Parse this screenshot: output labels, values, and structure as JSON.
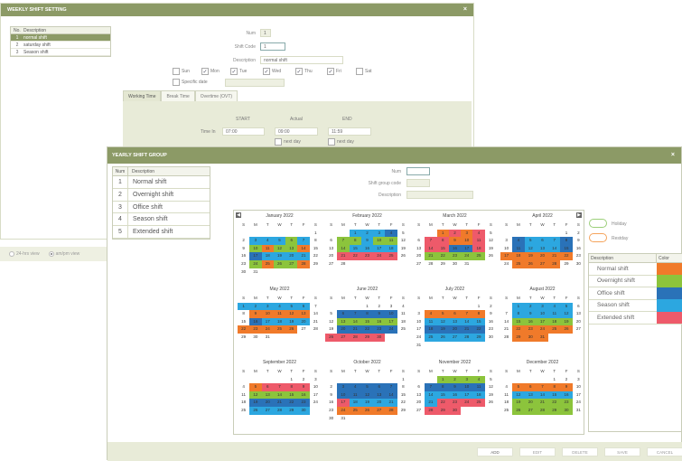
{
  "weekly": {
    "title": "WEEKLY SHIFT SETTING",
    "close": "×",
    "list": {
      "col_no": "No.",
      "col_desc": "Description",
      "rows": [
        {
          "no": "1",
          "desc": "normal shift"
        },
        {
          "no": "2",
          "desc": "saturday shift"
        },
        {
          "no": "3",
          "desc": "Season shift"
        }
      ]
    },
    "form": {
      "num_label": "Num",
      "num_value": "1",
      "code_label": "Shift Code",
      "code_value": "1",
      "desc_label": "Description",
      "desc_value": "normal shift",
      "days": [
        {
          "label": "Sun",
          "checked": false
        },
        {
          "label": "Mon",
          "checked": true
        },
        {
          "label": "Tue",
          "checked": true
        },
        {
          "label": "Wed",
          "checked": true
        },
        {
          "label": "Thu",
          "checked": true
        },
        {
          "label": "Fri",
          "checked": true
        },
        {
          "label": "Sat",
          "checked": false
        }
      ],
      "specific_label": "Specific date",
      "check_mark": "✓"
    },
    "tabs": [
      "Working Time",
      "Break Time",
      "Overtime (OVT)"
    ],
    "time": {
      "start_label": "START",
      "actual_label": "Actual",
      "end_label": "END",
      "timein_label": "Time In",
      "start_value": "07:00",
      "actual_value": "09:00",
      "end_value": "11:59",
      "next_day": "next day"
    }
  },
  "view_radios": [
    {
      "label": "24-hrs view",
      "on": false
    },
    {
      "label": "am/pm view",
      "on": true
    }
  ],
  "yearly": {
    "title": "YEARLY SHIFT GROUP",
    "close": "×",
    "list": {
      "col_no": "Num",
      "col_desc": "Description",
      "rows": [
        {
          "no": "1",
          "desc": "Normal shift"
        },
        {
          "no": "2",
          "desc": "Overnight shift"
        },
        {
          "no": "3",
          "desc": "Office shift"
        },
        {
          "no": "4",
          "desc": "Season shift"
        },
        {
          "no": "5",
          "desc": "Extended shift"
        }
      ]
    },
    "form": {
      "num_label": "Num",
      "num_value": "",
      "code_label": "Shift group code",
      "desc_label": "Description"
    },
    "nav_prev": "◀",
    "nav_next": "▶",
    "holiday_label": "Holiday",
    "restday_label": "Restday",
    "legend": {
      "col_desc": "Description",
      "col_color": "Color",
      "rows": [
        {
          "desc": "Normal shift",
          "color": "#f07a2a"
        },
        {
          "desc": "Overnight shift",
          "color": "#8cc43c"
        },
        {
          "desc": "Office shift",
          "color": "#2a72b8"
        },
        {
          "desc": "Season shift",
          "color": "#2ca7e0"
        },
        {
          "desc": "Extended shift",
          "color": "#ee5a6a"
        }
      ]
    },
    "buttons": [
      "ADD",
      "EDIT",
      "DELETE",
      "SAVE",
      "CANCEL"
    ],
    "weekday_headers": [
      "S",
      "M",
      "T",
      "W",
      "T",
      "F",
      "S"
    ],
    "colors": {
      "o": "#f07a2a",
      "g": "#8cc43c",
      "d": "#2a72b8",
      "b": "#2ca7e0",
      "r": "#ee5a6a"
    },
    "months": [
      {
        "name": "January 2022",
        "first": 6,
        "days": 31,
        "colors": "....._.b"
      },
      {
        "name": "February 2022",
        "first": 2,
        "days": 28
      },
      {
        "name": "March 2022",
        "first": 2,
        "days": 31
      },
      {
        "name": "April 2022",
        "first": 5,
        "days": 30
      },
      {
        "name": "May 2022",
        "first": 0,
        "days": 31
      },
      {
        "name": "June 2022",
        "first": 3,
        "days": 30
      },
      {
        "name": "July 2022",
        "first": 5,
        "days": 31
      },
      {
        "name": "August 2022",
        "first": 1,
        "days": 31
      },
      {
        "name": "September 2022",
        "first": 4,
        "days": 30
      },
      {
        "name": "October 2022",
        "first": 6,
        "days": 31
      },
      {
        "name": "November 2022",
        "first": 2,
        "days": 30
      },
      {
        "name": "December 2022",
        "first": 4,
        "days": 31
      }
    ],
    "month_colors": [
      {
        "3": "b",
        "4": "b",
        "5": "b",
        "6": "g",
        "7": "b",
        "10": "g",
        "11": "o",
        "12": "g",
        "13": "g",
        "14": "o",
        "17": "d",
        "18": "b",
        "19": "b",
        "20": "b",
        "21": "b",
        "24": "g",
        "25": "o",
        "26": "g",
        "27": "g",
        "28": "o"
      },
      {
        "1": "b",
        "2": "b",
        "3": "b",
        "4": "d",
        "7": "g",
        "8": "g",
        "9": "b",
        "10": "g",
        "11": "g",
        "14": "g",
        "15": "b",
        "16": "b",
        "17": "b",
        "18": "b",
        "21": "r",
        "22": "r",
        "23": "r",
        "24": "r",
        "25": "r"
      },
      {
        "1": "o",
        "2": "r",
        "3": "o",
        "4": "r",
        "7": "r",
        "8": "r",
        "9": "o",
        "10": "o",
        "11": "r",
        "14": "r",
        "15": "r",
        "16": "d",
        "17": "d",
        "18": "r",
        "21": "g",
        "22": "g",
        "23": "g",
        "24": "g",
        "25": "g"
      },
      {
        "4": "d",
        "5": "b",
        "6": "b",
        "7": "b",
        "8": "d",
        "11": "d",
        "12": "b",
        "13": "b",
        "14": "b",
        "15": "d",
        "17": "o",
        "18": "o",
        "19": "o",
        "20": "o",
        "21": "o",
        "22": "o",
        "25": "o",
        "26": "o",
        "27": "o",
        "28": "o"
      },
      {
        "1": "b",
        "2": "b",
        "3": "b",
        "4": "b",
        "5": "b",
        "6": "b",
        "9": "o",
        "10": "o",
        "11": "o",
        "12": "o",
        "13": "o",
        "16": "d",
        "17": "b",
        "18": "b",
        "19": "b",
        "20": "b",
        "22": "o",
        "23": "o",
        "24": "o",
        "25": "o",
        "26": "o"
      },
      {
        "6": "d",
        "7": "d",
        "8": "d",
        "9": "d",
        "10": "d",
        "13": "g",
        "14": "g",
        "15": "g",
        "16": "g",
        "17": "g",
        "20": "d",
        "21": "d",
        "22": "d",
        "23": "d",
        "24": "d",
        "26": "r",
        "27": "r",
        "28": "r",
        "29": "r",
        "30": "r"
      },
      {
        "4": "o",
        "5": "o",
        "6": "o",
        "7": "o",
        "8": "o",
        "11": "b",
        "12": "b",
        "13": "b",
        "14": "b",
        "15": "b",
        "18": "d",
        "19": "d",
        "20": "d",
        "21": "d",
        "22": "d",
        "25": "b",
        "26": "b",
        "27": "b",
        "28": "b",
        "29": "b"
      },
      {
        "1": "b",
        "2": "b",
        "3": "b",
        "4": "b",
        "5": "b",
        "8": "b",
        "9": "b",
        "10": "b",
        "11": "b",
        "12": "b",
        "15": "g",
        "16": "g",
        "17": "g",
        "18": "g",
        "19": "g",
        "22": "o",
        "23": "o",
        "24": "o",
        "25": "o",
        "26": "o",
        "29": "o",
        "30": "o",
        "31": "o"
      },
      {
        "5": "o",
        "6": "r",
        "7": "r",
        "8": "r",
        "9": "r",
        "12": "g",
        "13": "g",
        "14": "g",
        "15": "g",
        "16": "g",
        "19": "d",
        "20": "d",
        "21": "d",
        "22": "d",
        "23": "d",
        "26": "b",
        "27": "b",
        "28": "b",
        "29": "b",
        "30": "b"
      },
      {
        "3": "d",
        "4": "d",
        "5": "d",
        "6": "d",
        "7": "d",
        "10": "d",
        "11": "d",
        "12": "d",
        "13": "d",
        "14": "d",
        "17": "r",
        "18": "b",
        "19": "b",
        "20": "b",
        "21": "b",
        "24": "o",
        "25": "o",
        "26": "o",
        "27": "o",
        "28": "o"
      },
      {
        "1": "g",
        "2": "g",
        "3": "g",
        "4": "g",
        "7": "d",
        "8": "d",
        "9": "d",
        "10": "d",
        "11": "d",
        "14": "b",
        "15": "b",
        "16": "b",
        "17": "b",
        "18": "b",
        "21": "b",
        "22": "r",
        "23": "r",
        "24": "r",
        "25": "r",
        "28": "r",
        "29": "r",
        "30": "r"
      },
      {
        "5": "o",
        "6": "o",
        "7": "o",
        "8": "o",
        "9": "o",
        "12": "b",
        "13": "b",
        "14": "b",
        "15": "b",
        "16": "b",
        "19": "g",
        "20": "g",
        "21": "g",
        "22": "g",
        "23": "g",
        "26": "g",
        "27": "g",
        "28": "g",
        "29": "g",
        "30": "g"
      }
    ]
  }
}
